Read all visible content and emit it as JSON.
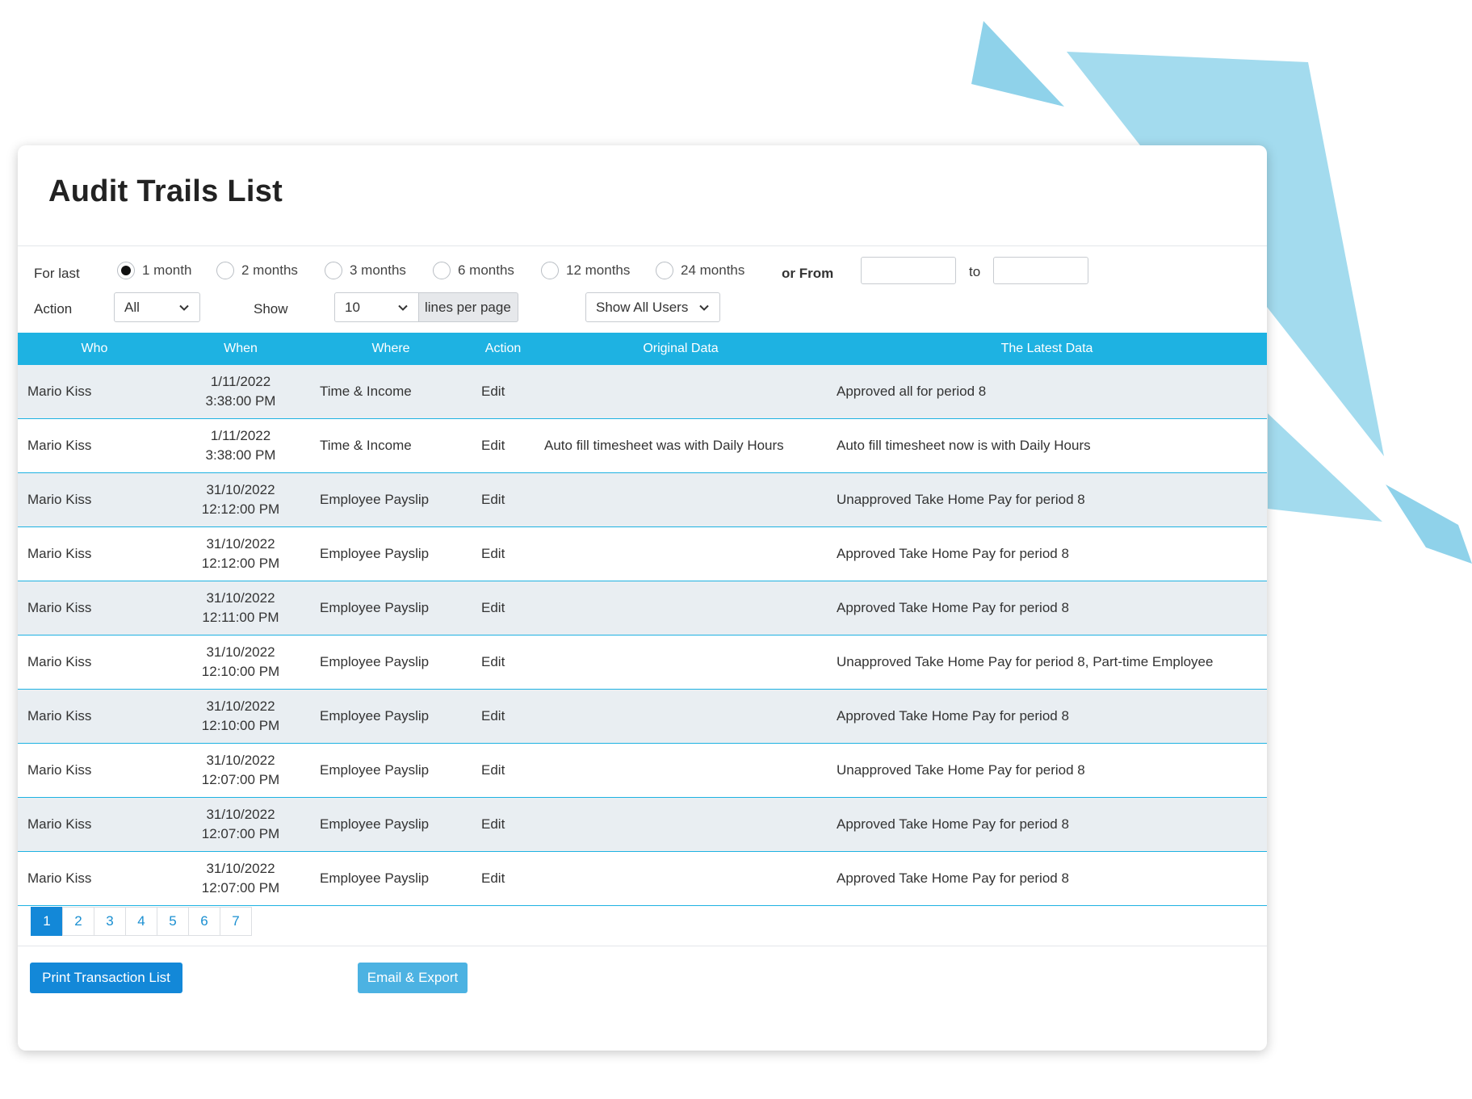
{
  "colors": {
    "header_bg": "#1eb2e2",
    "primary_button": "#1388d8",
    "secondary_button": "#4cb2e2",
    "row_alt": "#e9eef2",
    "decoration": "#8fd2ea"
  },
  "page_title": "Audit Trails List",
  "filters": {
    "for_last_label": "For last",
    "periods": [
      {
        "label": "1 month",
        "checked": true
      },
      {
        "label": "2 months",
        "checked": false
      },
      {
        "label": "3 months",
        "checked": false
      },
      {
        "label": "6 months",
        "checked": false
      },
      {
        "label": "12 months",
        "checked": false
      },
      {
        "label": "24 months",
        "checked": false
      }
    ],
    "or_from_label": "or From",
    "from_value": "",
    "to_label": "to",
    "to_value": "",
    "action_label": "Action",
    "action_value": "All",
    "show_label": "Show",
    "lines_value": "10",
    "lines_suffix": "lines per page",
    "users_value": "Show All Users"
  },
  "table": {
    "columns": [
      "Who",
      "When",
      "Where",
      "Action",
      "Original Data",
      "The Latest Data"
    ],
    "rows": [
      {
        "who": "Mario Kiss",
        "date": "1/11/2022",
        "time": "3:38:00 PM",
        "where": "Time & Income",
        "action": "Edit",
        "original": "",
        "latest": "Approved all for period 8"
      },
      {
        "who": "Mario Kiss",
        "date": "1/11/2022",
        "time": "3:38:00 PM",
        "where": "Time & Income",
        "action": "Edit",
        "original": "Auto fill timesheet was with Daily Hours",
        "latest": "Auto fill timesheet now is with Daily Hours"
      },
      {
        "who": "Mario Kiss",
        "date": "31/10/2022",
        "time": "12:12:00 PM",
        "where": "Employee Payslip",
        "action": "Edit",
        "original": "",
        "latest": "Unapproved Take Home Pay for period 8"
      },
      {
        "who": "Mario Kiss",
        "date": "31/10/2022",
        "time": "12:12:00 PM",
        "where": "Employee Payslip",
        "action": "Edit",
        "original": "",
        "latest": "Approved Take Home Pay for period 8"
      },
      {
        "who": "Mario Kiss",
        "date": "31/10/2022",
        "time": "12:11:00 PM",
        "where": "Employee Payslip",
        "action": "Edit",
        "original": "",
        "latest": "Approved Take Home Pay for period 8"
      },
      {
        "who": "Mario Kiss",
        "date": "31/10/2022",
        "time": "12:10:00 PM",
        "where": "Employee Payslip",
        "action": "Edit",
        "original": "",
        "latest": "Unapproved Take Home Pay for period 8, Part-time Employee"
      },
      {
        "who": "Mario Kiss",
        "date": "31/10/2022",
        "time": "12:10:00 PM",
        "where": "Employee Payslip",
        "action": "Edit",
        "original": "",
        "latest": "Approved Take Home Pay for period 8"
      },
      {
        "who": "Mario Kiss",
        "date": "31/10/2022",
        "time": "12:07:00 PM",
        "where": "Employee Payslip",
        "action": "Edit",
        "original": "",
        "latest": "Unapproved Take Home Pay for period 8"
      },
      {
        "who": "Mario Kiss",
        "date": "31/10/2022",
        "time": "12:07:00 PM",
        "where": "Employee Payslip",
        "action": "Edit",
        "original": "",
        "latest": "Approved Take Home Pay for period 8"
      },
      {
        "who": "Mario Kiss",
        "date": "31/10/2022",
        "time": "12:07:00 PM",
        "where": "Employee Payslip",
        "action": "Edit",
        "original": "",
        "latest": "Approved Take Home Pay for period 8"
      }
    ]
  },
  "pagination": {
    "pages": [
      "1",
      "2",
      "3",
      "4",
      "5",
      "6",
      "7"
    ],
    "current": "1"
  },
  "buttons": {
    "print": "Print Transaction List",
    "email_export": "Email & Export"
  }
}
